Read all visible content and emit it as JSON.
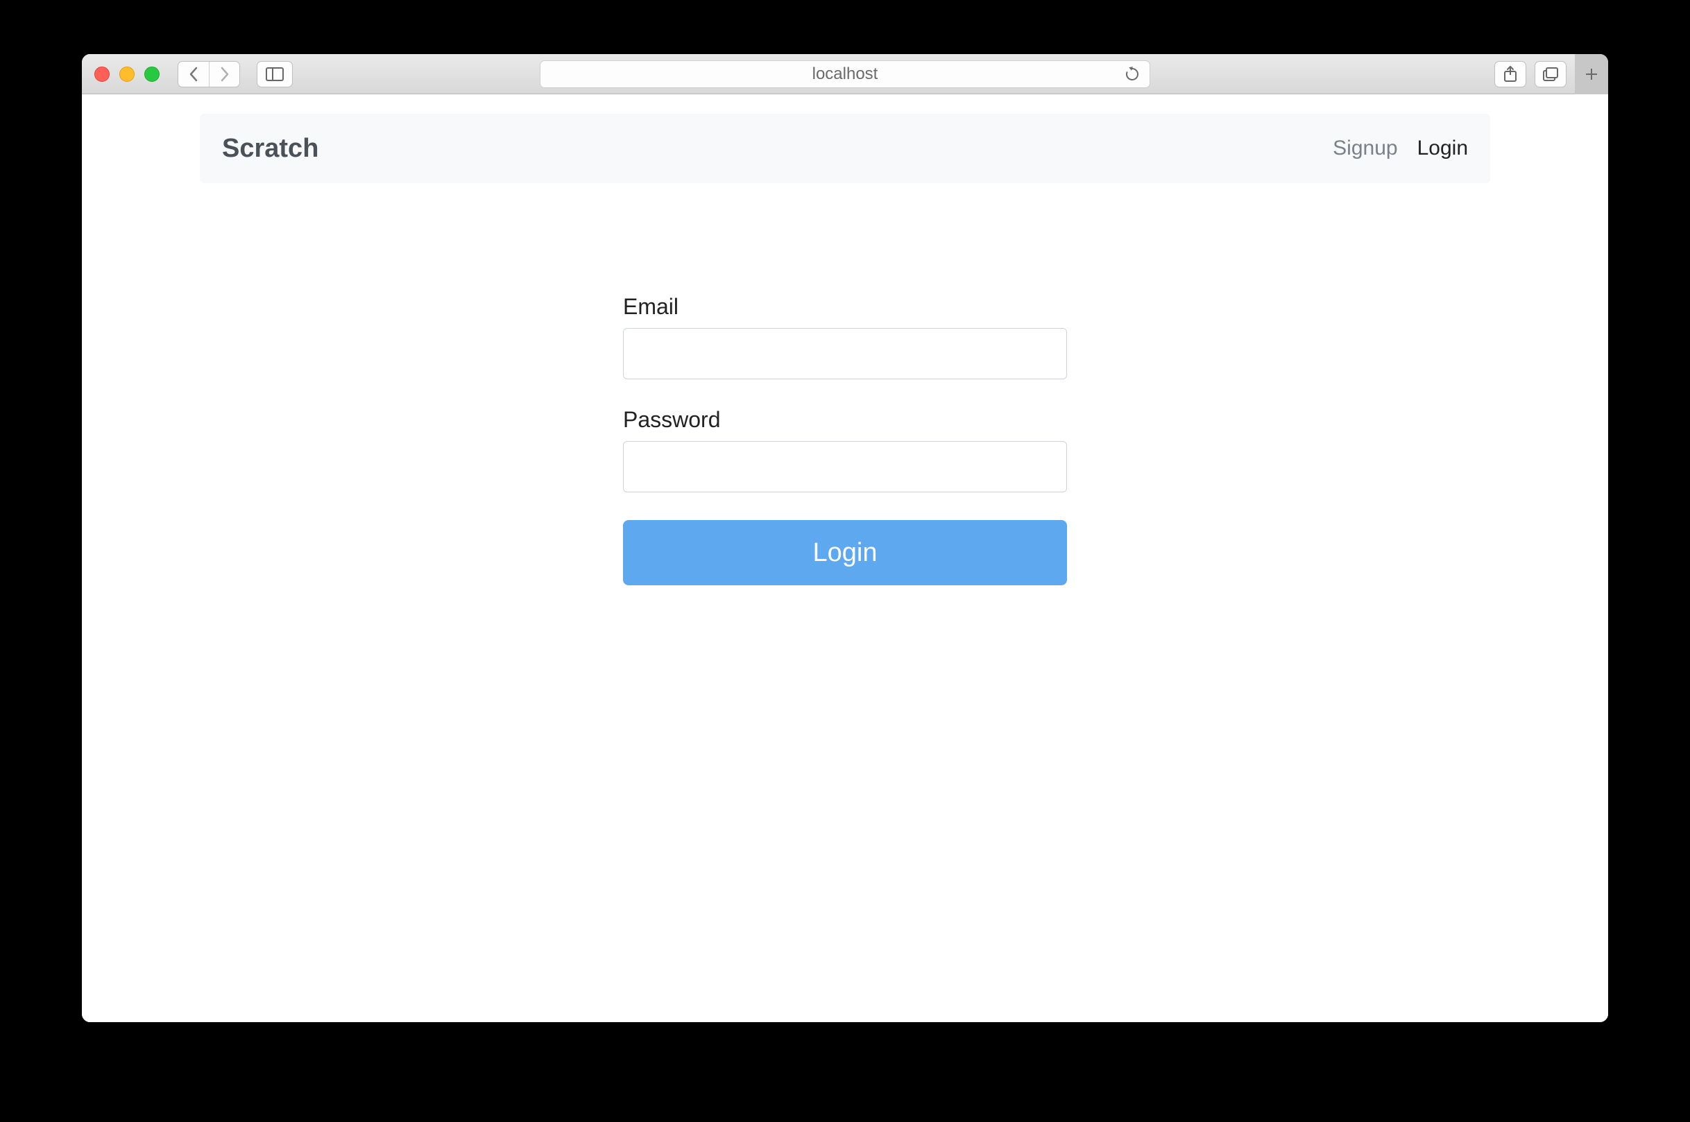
{
  "browser": {
    "url_display": "localhost"
  },
  "navbar": {
    "brand": "Scratch",
    "links": [
      {
        "label": "Signup"
      },
      {
        "label": "Login"
      }
    ]
  },
  "login_form": {
    "email_label": "Email",
    "email_value": "",
    "password_label": "Password",
    "password_value": "",
    "submit_label": "Login"
  },
  "colors": {
    "primary_button": "#5da8ef",
    "navbar_bg": "#f8f9fa",
    "brand_text": "#4a5159"
  }
}
